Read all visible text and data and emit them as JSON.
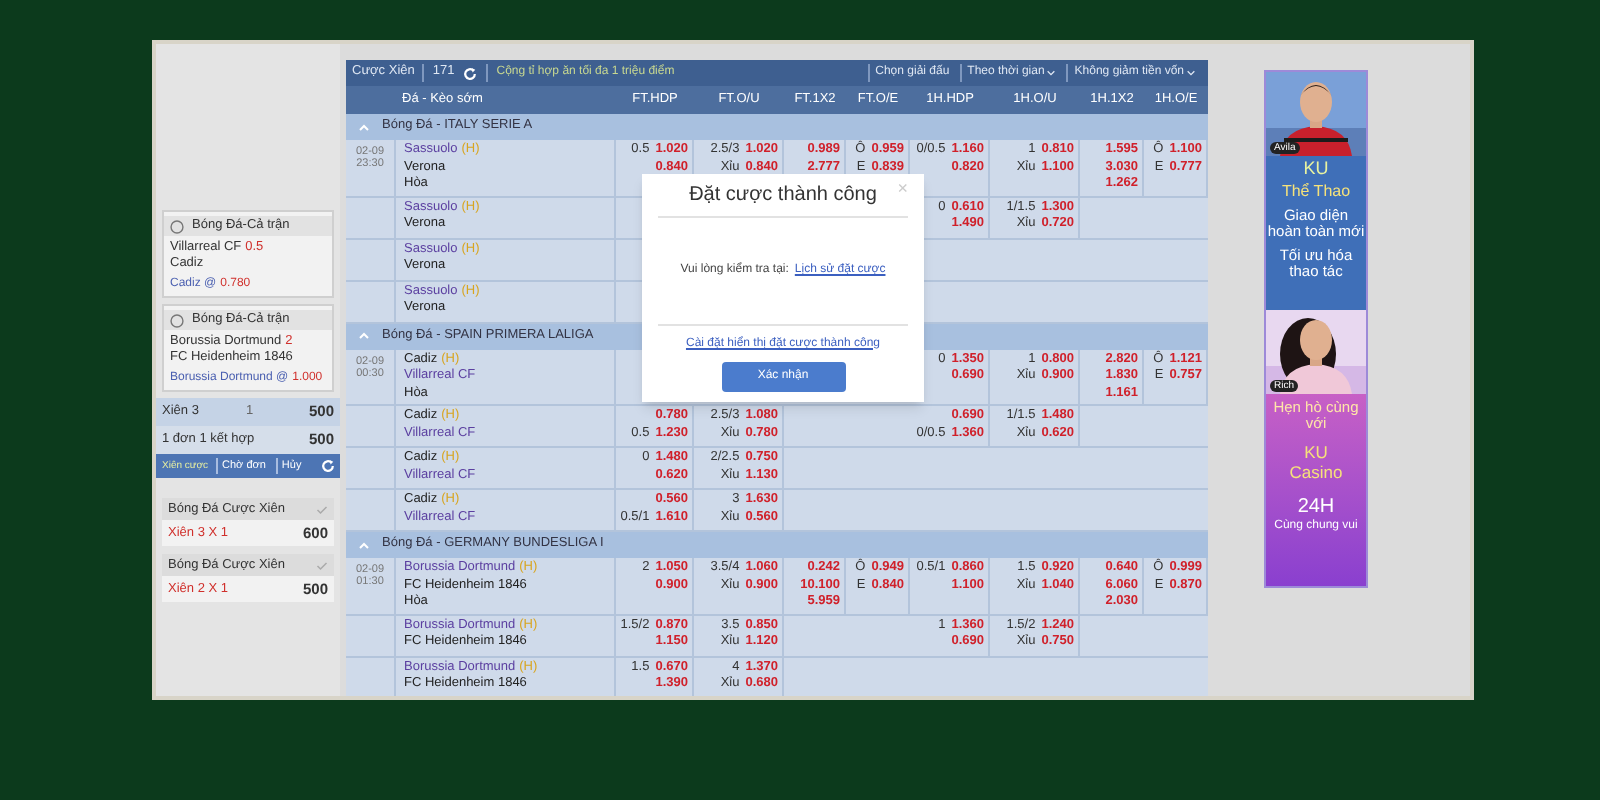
{
  "bet_slip": {
    "bets": [
      {
        "title": "Bóng Đá-Cả trận",
        "selection": "Villarreal CF",
        "handicap": "0.5",
        "opponent": "Cadiz",
        "pick": "Cadiz @",
        "odds": "0.780"
      },
      {
        "title": "Bóng Đá-Cả trận",
        "selection": "Borussia Dortmund",
        "handicap": "2",
        "opponent": "FC Heidenheim 1846",
        "pick": "Borussia Dortmund @",
        "odds": "1.000"
      }
    ],
    "combos": [
      {
        "label": "Xiên 3",
        "count": "1",
        "amount": "500",
        "kind": "combo"
      },
      {
        "label": "1 đơn 1 kết hợp",
        "amount": "500",
        "kind": "summary"
      }
    ],
    "actions": [
      {
        "label": "Xiên cược",
        "kind": "primary"
      },
      {
        "label": "Chờ đơn",
        "kind": "plain"
      },
      {
        "label": "Hủy",
        "kind": "plain"
      },
      {
        "kind": "refresh"
      }
    ],
    "history": [
      {
        "title": "Bóng Đá Cược Xiên",
        "combo": "Xiên 3 X 1",
        "amount": "600"
      },
      {
        "title": "Bóng Đá Cược Xiên",
        "combo": "Xiên 2 X 1",
        "amount": "500"
      }
    ]
  },
  "table": {
    "toolbar": {
      "title": "Cược Xiên",
      "count": "171",
      "note": "Cộng tỉ hợp ăn tối đa 1 triệu điểm",
      "filters": [
        "Chọn giải đấu",
        "Theo thời gian",
        "Không giảm tiền vốn"
      ]
    },
    "header": "Đá - Kèo sớm",
    "columns": [
      "FT.HDP",
      "FT.O/U",
      "FT.1X2",
      "FT.O/E",
      "1H.HDP",
      "1H.O/U",
      "1H.1X2",
      "1H.O/E"
    ],
    "leagues": [
      {
        "name": "Bóng Đá - ITALY SERIE A",
        "matches": [
          {
            "time": [
              "02-09",
              "23:30"
            ],
            "teams": [
              {
                "name": "Sassuolo",
                "marker": "(H)",
                "favorite": true
              },
              {
                "name": "Verona",
                "favorite": false
              }
            ],
            "draw": "Hòa",
            "full_time": {
              "hdp": [
                {
                  "line": "0.5",
                  "odds": "1.020"
                },
                {
                  "odds": "0.840"
                }
              ],
              "ou": [
                {
                  "line": "2.5/3",
                  "odds": "1.020"
                },
                {
                  "line": "Xỉu",
                  "odds": "0.840"
                }
              ],
              "x12": [
                {
                  "odds": "0.989"
                },
                {
                  "odds": "2.777"
                }
              ],
              "oe": [
                {
                  "line": "Ô",
                  "odds": "0.959"
                },
                {
                  "line": "E",
                  "odds": "0.839"
                }
              ]
            },
            "first_half": {
              "hdp": [
                {
                  "line": "0/0.5",
                  "odds": "1.160"
                },
                {
                  "odds": "0.820"
                }
              ],
              "ou": [
                {
                  "line": "1",
                  "odds": "0.810"
                },
                {
                  "line": "Xỉu",
                  "odds": "1.100"
                }
              ],
              "x12": [
                {
                  "odds": "1.595"
                },
                {
                  "odds": "3.030"
                },
                {
                  "odds": "1.262"
                }
              ],
              "oe": [
                {
                  "line": "Ô",
                  "odds": "1.100"
                },
                {
                  "line": "E",
                  "odds": "0.777"
                }
              ]
            }
          },
          {
            "teams": [
              {
                "name": "Sassuolo",
                "marker": "(H)",
                "favorite": true
              },
              {
                "name": "Verona",
                "favorite": false
              }
            ],
            "first_half": {
              "hdp": [
                {
                  "line": "0",
                  "odds": "0.610"
                },
                {
                  "odds": "1.490"
                }
              ],
              "ou": [
                {
                  "line": "1/1.5",
                  "odds": "1.300"
                },
                {
                  "line": "Xỉu",
                  "odds": "0.720"
                }
              ]
            }
          },
          {
            "teams": [
              {
                "name": "Sassuolo",
                "marker": "(H)",
                "favorite": true
              },
              {
                "name": "Verona",
                "favorite": false
              }
            ]
          },
          {
            "teams": [
              {
                "name": "Sassuolo",
                "marker": "(H)",
                "favorite": true
              },
              {
                "name": "Verona",
                "favorite": false
              }
            ]
          }
        ]
      },
      {
        "name": "Bóng Đá - SPAIN PRIMERA LALIGA",
        "matches": [
          {
            "time": [
              "02-09",
              "00:30"
            ],
            "teams": [
              {
                "name": "Cadiz",
                "marker": "(H)",
                "favorite": false
              },
              {
                "name": "Villarreal CF",
                "favorite": true
              }
            ],
            "draw": "Hòa",
            "first_half": {
              "hdp": [
                {
                  "line": "0",
                  "odds": "1.350"
                },
                {
                  "odds": "0.690"
                }
              ],
              "ou": [
                {
                  "line": "1",
                  "odds": "0.800"
                },
                {
                  "line": "Xỉu",
                  "odds": "0.900"
                }
              ],
              "x12": [
                {
                  "odds": "2.820"
                },
                {
                  "odds": "1.830"
                },
                {
                  "odds": "1.161"
                }
              ],
              "oe": [
                {
                  "line": "Ô",
                  "odds": "1.121"
                },
                {
                  "line": "E",
                  "odds": "0.757"
                }
              ]
            }
          },
          {
            "teams": [
              {
                "name": "Cadiz",
                "marker": "(H)",
                "favorite": false
              },
              {
                "name": "Villarreal CF",
                "favorite": true
              }
            ],
            "full_time": {
              "hdp": [
                {
                  "odds": "0.780"
                },
                {
                  "line": "0.5",
                  "odds": "1.230"
                }
              ],
              "ou": [
                {
                  "line": "2.5/3",
                  "odds": "1.080"
                },
                {
                  "line": "Xỉu",
                  "odds": "0.780"
                }
              ]
            },
            "first_half": {
              "hdp": [
                {
                  "odds": "0.690"
                },
                {
                  "line": "0/0.5",
                  "odds": "1.360"
                }
              ],
              "ou": [
                {
                  "line": "1/1.5",
                  "odds": "1.480"
                },
                {
                  "line": "Xỉu",
                  "odds": "0.620"
                }
              ]
            }
          },
          {
            "teams": [
              {
                "name": "Cadiz",
                "marker": "(H)",
                "favorite": false
              },
              {
                "name": "Villarreal CF",
                "favorite": true
              }
            ],
            "full_time": {
              "hdp": [
                {
                  "line": "0",
                  "odds": "1.480"
                },
                {
                  "odds": "0.620"
                }
              ],
              "ou": [
                {
                  "line": "2/2.5",
                  "odds": "0.750"
                },
                {
                  "line": "Xỉu",
                  "odds": "1.130"
                }
              ]
            }
          },
          {
            "teams": [
              {
                "name": "Cadiz",
                "marker": "(H)",
                "favorite": false
              },
              {
                "name": "Villarreal CF",
                "favorite": true
              }
            ],
            "full_time": {
              "hdp": [
                {
                  "odds": "0.560"
                },
                {
                  "line": "0.5/1",
                  "odds": "1.610"
                }
              ],
              "ou": [
                {
                  "line": "3",
                  "odds": "1.630"
                },
                {
                  "line": "Xỉu",
                  "odds": "0.560"
                }
              ]
            }
          }
        ]
      },
      {
        "name": "Bóng Đá - GERMANY BUNDESLIGA I",
        "matches": [
          {
            "time": [
              "02-09",
              "01:30"
            ],
            "teams": [
              {
                "name": "Borussia Dortmund",
                "marker": "(H)",
                "favorite": true
              },
              {
                "name": "FC Heidenheim 1846",
                "favorite": false
              }
            ],
            "draw": "Hòa",
            "full_time": {
              "hdp": [
                {
                  "line": "2",
                  "odds": "1.050"
                },
                {
                  "odds": "0.900"
                }
              ],
              "ou": [
                {
                  "line": "3.5/4",
                  "odds": "1.060"
                },
                {
                  "line": "Xỉu",
                  "odds": "0.900"
                }
              ],
              "x12": [
                {
                  "odds": "0.242"
                },
                {
                  "odds": "10.100"
                },
                {
                  "odds": "5.959"
                }
              ],
              "oe": [
                {
                  "line": "Ô",
                  "odds": "0.949"
                },
                {
                  "line": "E",
                  "odds": "0.840"
                }
              ]
            },
            "first_half": {
              "hdp": [
                {
                  "line": "0.5/1",
                  "odds": "0.860"
                },
                {
                  "odds": "1.100"
                }
              ],
              "ou": [
                {
                  "line": "1.5",
                  "odds": "0.920"
                },
                {
                  "line": "Xỉu",
                  "odds": "1.040"
                }
              ],
              "x12": [
                {
                  "odds": "0.640"
                },
                {
                  "odds": "6.060"
                },
                {
                  "odds": "2.030"
                }
              ],
              "oe": [
                {
                  "line": "Ô",
                  "odds": "0.999"
                },
                {
                  "line": "E",
                  "odds": "0.870"
                }
              ]
            }
          },
          {
            "teams": [
              {
                "name": "Borussia Dortmund",
                "marker": "(H)",
                "favorite": true
              },
              {
                "name": "FC Heidenheim 1846",
                "favorite": false
              }
            ],
            "full_time": {
              "hdp": [
                {
                  "line": "1.5/2",
                  "odds": "0.870"
                },
                {
                  "odds": "1.150"
                }
              ],
              "ou": [
                {
                  "line": "3.5",
                  "odds": "0.850"
                },
                {
                  "line": "Xỉu",
                  "odds": "1.120"
                }
              ]
            },
            "first_half": {
              "hdp": [
                {
                  "line": "1",
                  "odds": "1.360"
                },
                {
                  "odds": "0.690"
                }
              ],
              "ou": [
                {
                  "line": "1.5/2",
                  "odds": "1.240"
                },
                {
                  "line": "Xỉu",
                  "odds": "0.750"
                }
              ]
            }
          },
          {
            "teams": [
              {
                "name": "Borussia Dortmund",
                "marker": "(H)",
                "favorite": true
              },
              {
                "name": "FC Heidenheim 1846",
                "favorite": false
              }
            ],
            "full_time": {
              "hdp": [
                {
                  "line": "1.5",
                  "odds": "0.670"
                },
                {
                  "odds": "1.390"
                }
              ],
              "ou": [
                {
                  "line": "4",
                  "odds": "1.370"
                },
                {
                  "line": "Xỉu",
                  "odds": "0.680"
                }
              ]
            }
          }
        ]
      }
    ]
  },
  "modal": {
    "title": "Đặt cược thành công",
    "close": "×",
    "message": "Vui lòng kiểm tra tại:",
    "history_link": "Lịch sử đặt cược",
    "settings_link": "Cài đặt hiển thị đặt cược thành công",
    "confirm": "Xác nhận"
  },
  "ad": {
    "sections": [
      {
        "kind": "sport",
        "badge": "Avila",
        "brand": "KU",
        "product": "Thể Thao",
        "lines": [
          "Giao diện hoàn toàn mới",
          "Tối ưu hóa thao tác"
        ]
      },
      {
        "kind": "casino",
        "badge": "Rich",
        "lines": [
          "Hẹn hò cùng với"
        ],
        "brand": "KU",
        "product": "Casino",
        "extra": "24H",
        "slogan": "Cùng chung vui"
      }
    ]
  }
}
